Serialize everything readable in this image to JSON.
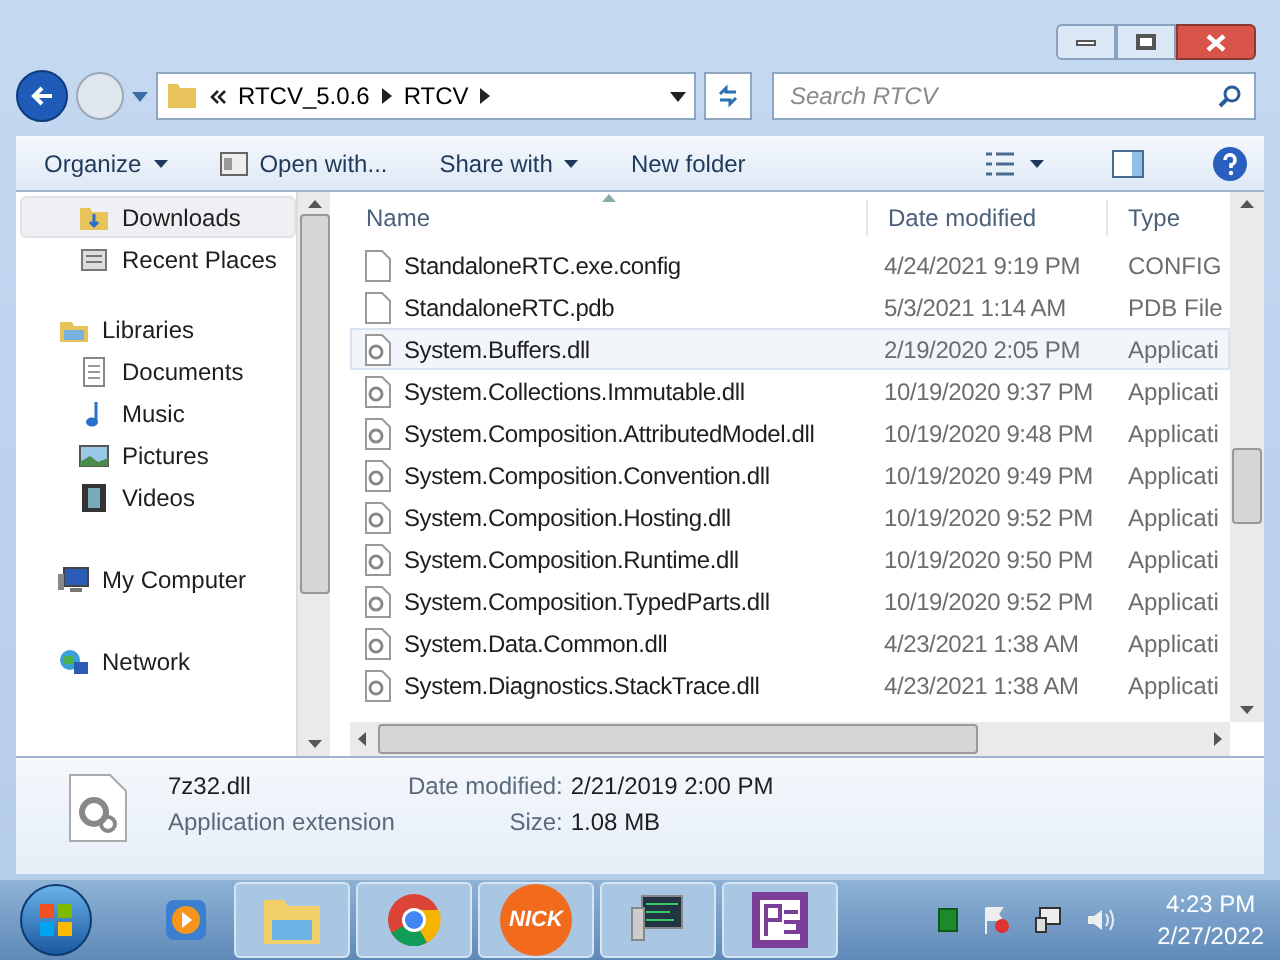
{
  "address": {
    "path": [
      "RTCV_5.0.6",
      "RTCV"
    ]
  },
  "search": {
    "placeholder": "Search RTCV"
  },
  "toolbar": [
    {
      "label": "Organize",
      "kind": "menu"
    },
    {
      "label": "Open with...",
      "kind": "icon"
    },
    {
      "label": "Share with",
      "kind": "menu"
    },
    {
      "label": "New folder",
      "kind": "plain"
    }
  ],
  "sidebar": {
    "items": [
      {
        "children": [
          {
            "label": "Downloads",
            "kind": "downloads",
            "selected": true
          },
          {
            "label": "Recent Places",
            "kind": "recent",
            "selected": false
          }
        ]
      },
      {
        "label": "Libraries",
        "kind": "library",
        "selected": false,
        "children": [
          {
            "label": "Documents",
            "kind": "documents",
            "selected": false
          },
          {
            "label": "Music",
            "kind": "music",
            "selected": false
          },
          {
            "label": "Pictures",
            "kind": "pictures",
            "selected": false
          },
          {
            "label": "Videos",
            "kind": "videos",
            "selected": false
          }
        ]
      },
      {
        "label": "My Computer",
        "kind": "computer",
        "selected": false
      },
      {
        "label": "Network",
        "kind": "network",
        "selected": false
      }
    ]
  },
  "table": {
    "columns": [
      "Name",
      "Date modified",
      "Type"
    ],
    "rows": [
      {
        "name": "StandaloneRTC.exe.config",
        "date": "4/24/2021 9:19 PM",
        "type": "CONFIG",
        "kind": "file",
        "selected": false
      },
      {
        "name": "StandaloneRTC.pdb",
        "date": "5/3/2021 1:14 AM",
        "type": "PDB File",
        "kind": "file",
        "selected": false
      },
      {
        "name": "System.Buffers.dll",
        "date": "2/19/2020 2:05 PM",
        "type": "Applicati",
        "kind": "dll",
        "selected": true
      },
      {
        "name": "System.Collections.Immutable.dll",
        "date": "10/19/2020 9:37 PM",
        "type": "Applicati",
        "kind": "dll",
        "selected": false
      },
      {
        "name": "System.Composition.AttributedModel.dll",
        "date": "10/19/2020 9:48 PM",
        "type": "Applicati",
        "kind": "dll",
        "selected": false
      },
      {
        "name": "System.Composition.Convention.dll",
        "date": "10/19/2020 9:49 PM",
        "type": "Applicati",
        "kind": "dll",
        "selected": false
      },
      {
        "name": "System.Composition.Hosting.dll",
        "date": "10/19/2020 9:52 PM",
        "type": "Applicati",
        "kind": "dll",
        "selected": false
      },
      {
        "name": "System.Composition.Runtime.dll",
        "date": "10/19/2020 9:50 PM",
        "type": "Applicati",
        "kind": "dll",
        "selected": false
      },
      {
        "name": "System.Composition.TypedParts.dll",
        "date": "10/19/2020 9:52 PM",
        "type": "Applicati",
        "kind": "dll",
        "selected": false
      },
      {
        "name": "System.Data.Common.dll",
        "date": "4/23/2021 1:38 AM",
        "type": "Applicati",
        "kind": "dll",
        "selected": false
      },
      {
        "name": "System.Diagnostics.StackTrace.dll",
        "date": "4/23/2021 1:38 AM",
        "type": "Applicati",
        "kind": "dll",
        "selected": false
      }
    ]
  },
  "details": {
    "name": "7z32.dll",
    "type": "Application extension",
    "fields": [
      {
        "label": "Date modified:",
        "value": "2/21/2019 2:00 PM"
      },
      {
        "label": "Size:",
        "value": "1.08 MB"
      }
    ]
  },
  "taskbar": {
    "apps": [
      {
        "kind": "media"
      },
      {
        "kind": "explorer"
      },
      {
        "kind": "chrome"
      },
      {
        "kind": "nick",
        "label": "NICK"
      },
      {
        "kind": "monitor"
      },
      {
        "kind": "ps"
      }
    ],
    "time": "4:23 PM",
    "date": "2/27/2022"
  }
}
